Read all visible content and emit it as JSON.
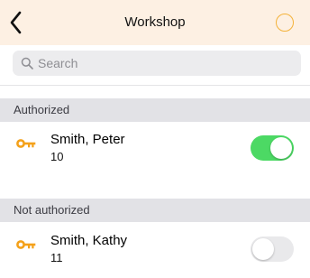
{
  "nav": {
    "title": "Workshop",
    "back_icon": "chevron-left-icon",
    "action_icon": "circle-outline-icon"
  },
  "search": {
    "placeholder": "Search",
    "icon": "search-icon"
  },
  "colors": {
    "nav_background": "#fdf0e3",
    "accent": "#f4b23a",
    "toggle_on": "#4cd964",
    "toggle_off": "#e9e9eb",
    "section_header": "#e2e2e6"
  },
  "sections": [
    {
      "header": "Authorized",
      "rows": [
        {
          "name": "Smith, Peter",
          "number": "10",
          "icon": "key-icon",
          "enabled": true
        }
      ]
    },
    {
      "header": "Not authorized",
      "rows": [
        {
          "name": "Smith, Kathy",
          "number": "11",
          "icon": "key-icon",
          "enabled": false
        }
      ]
    }
  ]
}
